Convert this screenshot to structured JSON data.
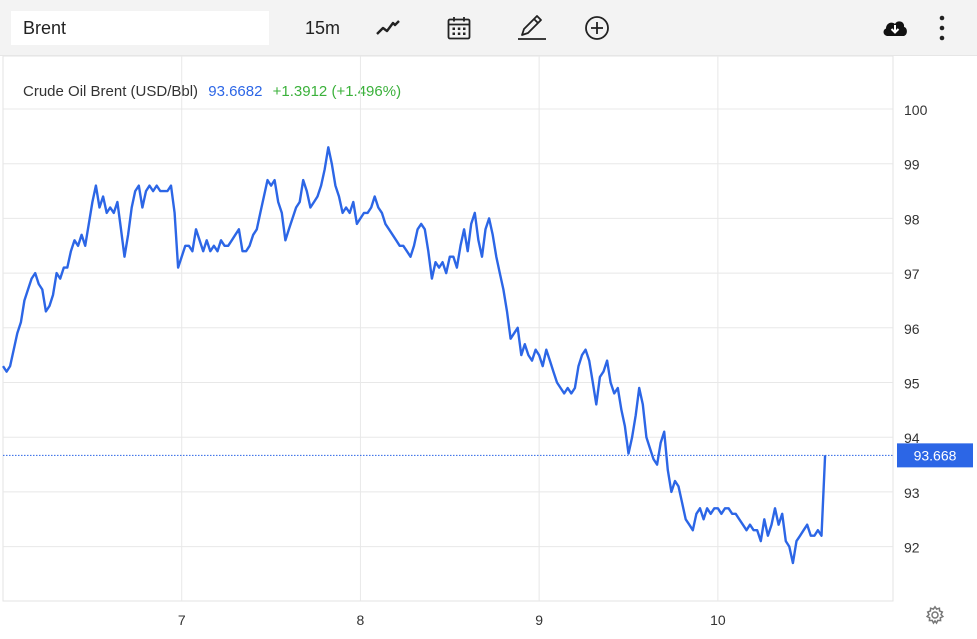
{
  "toolbar": {
    "symbol_value": "Brent",
    "interval_label": "15m",
    "icons": [
      "line-chart-icon",
      "calendar-icon",
      "pencil-icon",
      "add-circle-icon",
      "cloud-download-icon",
      "more-vertical-icon"
    ]
  },
  "legend": {
    "title": "Crude Oil Brent (USD/Bbl)",
    "last": "93.6682",
    "change": "+1.3912 (+1.496%)"
  },
  "colors": {
    "line": "#2c66e6",
    "positive": "#3bb13b",
    "grid": "#e8e8e8",
    "price_tag": "#2c66e6"
  },
  "chart_data": {
    "type": "line",
    "title": "",
    "xlabel": "",
    "ylabel": "",
    "ylim": [
      91.0,
      100.8
    ],
    "y_ticks": [
      92,
      93,
      94,
      95,
      96,
      97,
      98,
      99,
      100
    ],
    "x_ticks": [
      {
        "x": 7,
        "label": "7"
      },
      {
        "x": 8,
        "label": "8"
      },
      {
        "x": 9,
        "label": "9"
      },
      {
        "x": 10,
        "label": "10"
      }
    ],
    "xlim": [
      6.0,
      10.98
    ],
    "last_price_label": "93.668",
    "last_price": 93.668,
    "grid": true,
    "series": [
      {
        "points": [
          [
            6.0,
            95.3
          ],
          [
            6.02,
            95.2
          ],
          [
            6.04,
            95.3
          ],
          [
            6.06,
            95.6
          ],
          [
            6.08,
            95.9
          ],
          [
            6.1,
            96.1
          ],
          [
            6.12,
            96.5
          ],
          [
            6.14,
            96.7
          ],
          [
            6.16,
            96.9
          ],
          [
            6.18,
            97.0
          ],
          [
            6.2,
            96.8
          ],
          [
            6.22,
            96.7
          ],
          [
            6.24,
            96.3
          ],
          [
            6.26,
            96.4
          ],
          [
            6.28,
            96.6
          ],
          [
            6.3,
            97.0
          ],
          [
            6.32,
            96.9
          ],
          [
            6.34,
            97.1
          ],
          [
            6.36,
            97.1
          ],
          [
            6.38,
            97.4
          ],
          [
            6.4,
            97.6
          ],
          [
            6.42,
            97.5
          ],
          [
            6.44,
            97.7
          ],
          [
            6.46,
            97.5
          ],
          [
            6.48,
            97.9
          ],
          [
            6.5,
            98.3
          ],
          [
            6.52,
            98.6
          ],
          [
            6.54,
            98.2
          ],
          [
            6.56,
            98.4
          ],
          [
            6.58,
            98.1
          ],
          [
            6.6,
            98.2
          ],
          [
            6.62,
            98.1
          ],
          [
            6.64,
            98.3
          ],
          [
            6.66,
            97.8
          ],
          [
            6.68,
            97.3
          ],
          [
            6.7,
            97.7
          ],
          [
            6.72,
            98.2
          ],
          [
            6.74,
            98.5
          ],
          [
            6.76,
            98.6
          ],
          [
            6.78,
            98.2
          ],
          [
            6.8,
            98.5
          ],
          [
            6.82,
            98.6
          ],
          [
            6.84,
            98.5
          ],
          [
            6.86,
            98.6
          ],
          [
            6.88,
            98.5
          ],
          [
            6.9,
            98.5
          ],
          [
            6.92,
            98.5
          ],
          [
            6.94,
            98.6
          ],
          [
            6.96,
            98.1
          ],
          [
            6.98,
            97.1
          ],
          [
            7.0,
            97.3
          ],
          [
            7.02,
            97.5
          ],
          [
            7.04,
            97.5
          ],
          [
            7.06,
            97.4
          ],
          [
            7.08,
            97.8
          ],
          [
            7.1,
            97.6
          ],
          [
            7.12,
            97.4
          ],
          [
            7.14,
            97.6
          ],
          [
            7.16,
            97.4
          ],
          [
            7.18,
            97.5
          ],
          [
            7.2,
            97.4
          ],
          [
            7.22,
            97.6
          ],
          [
            7.24,
            97.5
          ],
          [
            7.26,
            97.5
          ],
          [
            7.28,
            97.6
          ],
          [
            7.3,
            97.7
          ],
          [
            7.32,
            97.8
          ],
          [
            7.34,
            97.4
          ],
          [
            7.36,
            97.4
          ],
          [
            7.38,
            97.5
          ],
          [
            7.4,
            97.7
          ],
          [
            7.42,
            97.8
          ],
          [
            7.44,
            98.1
          ],
          [
            7.46,
            98.4
          ],
          [
            7.48,
            98.7
          ],
          [
            7.5,
            98.6
          ],
          [
            7.52,
            98.7
          ],
          [
            7.54,
            98.3
          ],
          [
            7.56,
            98.1
          ],
          [
            7.58,
            97.6
          ],
          [
            7.6,
            97.8
          ],
          [
            7.62,
            98.0
          ],
          [
            7.64,
            98.2
          ],
          [
            7.66,
            98.3
          ],
          [
            7.68,
            98.7
          ],
          [
            7.7,
            98.5
          ],
          [
            7.72,
            98.2
          ],
          [
            7.74,
            98.3
          ],
          [
            7.76,
            98.4
          ],
          [
            7.78,
            98.6
          ],
          [
            7.8,
            98.9
          ],
          [
            7.82,
            99.3
          ],
          [
            7.84,
            99.0
          ],
          [
            7.86,
            98.6
          ],
          [
            7.88,
            98.4
          ],
          [
            7.9,
            98.1
          ],
          [
            7.92,
            98.2
          ],
          [
            7.94,
            98.1
          ],
          [
            7.96,
            98.3
          ],
          [
            7.98,
            97.9
          ],
          [
            8.0,
            98.0
          ],
          [
            8.02,
            98.1
          ],
          [
            8.04,
            98.1
          ],
          [
            8.06,
            98.2
          ],
          [
            8.08,
            98.4
          ],
          [
            8.1,
            98.2
          ],
          [
            8.12,
            98.1
          ],
          [
            8.14,
            97.9
          ],
          [
            8.16,
            97.8
          ],
          [
            8.18,
            97.7
          ],
          [
            8.2,
            97.6
          ],
          [
            8.22,
            97.5
          ],
          [
            8.24,
            97.5
          ],
          [
            8.26,
            97.4
          ],
          [
            8.28,
            97.3
          ],
          [
            8.3,
            97.5
          ],
          [
            8.32,
            97.8
          ],
          [
            8.34,
            97.9
          ],
          [
            8.36,
            97.8
          ],
          [
            8.38,
            97.4
          ],
          [
            8.4,
            96.9
          ],
          [
            8.42,
            97.2
          ],
          [
            8.44,
            97.1
          ],
          [
            8.46,
            97.2
          ],
          [
            8.48,
            97.0
          ],
          [
            8.5,
            97.3
          ],
          [
            8.52,
            97.3
          ],
          [
            8.54,
            97.1
          ],
          [
            8.56,
            97.5
          ],
          [
            8.58,
            97.8
          ],
          [
            8.6,
            97.4
          ],
          [
            8.62,
            97.9
          ],
          [
            8.64,
            98.1
          ],
          [
            8.66,
            97.6
          ],
          [
            8.68,
            97.3
          ],
          [
            8.7,
            97.8
          ],
          [
            8.72,
            98.0
          ],
          [
            8.74,
            97.7
          ],
          [
            8.76,
            97.3
          ],
          [
            8.78,
            97.0
          ],
          [
            8.8,
            96.7
          ],
          [
            8.82,
            96.3
          ],
          [
            8.84,
            95.8
          ],
          [
            8.86,
            95.9
          ],
          [
            8.88,
            96.0
          ],
          [
            8.9,
            95.5
          ],
          [
            8.92,
            95.7
          ],
          [
            8.94,
            95.5
          ],
          [
            8.96,
            95.4
          ],
          [
            8.98,
            95.6
          ],
          [
            9.0,
            95.5
          ],
          [
            9.02,
            95.3
          ],
          [
            9.04,
            95.6
          ],
          [
            9.06,
            95.4
          ],
          [
            9.08,
            95.2
          ],
          [
            9.1,
            95.0
          ],
          [
            9.12,
            94.9
          ],
          [
            9.14,
            94.8
          ],
          [
            9.16,
            94.9
          ],
          [
            9.18,
            94.8
          ],
          [
            9.2,
            94.9
          ],
          [
            9.22,
            95.3
          ],
          [
            9.24,
            95.5
          ],
          [
            9.26,
            95.6
          ],
          [
            9.28,
            95.4
          ],
          [
            9.3,
            95.0
          ],
          [
            9.32,
            94.6
          ],
          [
            9.34,
            95.1
          ],
          [
            9.36,
            95.2
          ],
          [
            9.38,
            95.4
          ],
          [
            9.4,
            95.0
          ],
          [
            9.42,
            94.8
          ],
          [
            9.44,
            94.9
          ],
          [
            9.46,
            94.5
          ],
          [
            9.48,
            94.2
          ],
          [
            9.5,
            93.7
          ],
          [
            9.52,
            94.0
          ],
          [
            9.54,
            94.4
          ],
          [
            9.56,
            94.9
          ],
          [
            9.58,
            94.6
          ],
          [
            9.6,
            94.0
          ],
          [
            9.62,
            93.8
          ],
          [
            9.64,
            93.6
          ],
          [
            9.66,
            93.5
          ],
          [
            9.68,
            93.9
          ],
          [
            9.7,
            94.1
          ],
          [
            9.72,
            93.4
          ],
          [
            9.74,
            93.0
          ],
          [
            9.76,
            93.2
          ],
          [
            9.78,
            93.1
          ],
          [
            9.8,
            92.8
          ],
          [
            9.82,
            92.5
          ],
          [
            9.84,
            92.4
          ],
          [
            9.86,
            92.3
          ],
          [
            9.88,
            92.6
          ],
          [
            9.9,
            92.7
          ],
          [
            9.92,
            92.5
          ],
          [
            9.94,
            92.7
          ],
          [
            9.96,
            92.6
          ],
          [
            9.98,
            92.7
          ],
          [
            10.0,
            92.7
          ],
          [
            10.02,
            92.6
          ],
          [
            10.04,
            92.7
          ],
          [
            10.06,
            92.7
          ],
          [
            10.08,
            92.6
          ],
          [
            10.1,
            92.6
          ],
          [
            10.12,
            92.5
          ],
          [
            10.14,
            92.4
          ],
          [
            10.16,
            92.3
          ],
          [
            10.18,
            92.4
          ],
          [
            10.2,
            92.3
          ],
          [
            10.22,
            92.3
          ],
          [
            10.24,
            92.1
          ],
          [
            10.26,
            92.5
          ],
          [
            10.28,
            92.2
          ],
          [
            10.3,
            92.4
          ],
          [
            10.32,
            92.7
          ],
          [
            10.34,
            92.4
          ],
          [
            10.36,
            92.6
          ],
          [
            10.38,
            92.1
          ],
          [
            10.4,
            92.0
          ],
          [
            10.42,
            91.7
          ],
          [
            10.44,
            92.1
          ],
          [
            10.46,
            92.2
          ],
          [
            10.48,
            92.3
          ],
          [
            10.5,
            92.4
          ],
          [
            10.52,
            92.2
          ],
          [
            10.54,
            92.2
          ],
          [
            10.56,
            92.3
          ],
          [
            10.58,
            92.2
          ],
          [
            10.6,
            93.67
          ]
        ]
      }
    ]
  }
}
